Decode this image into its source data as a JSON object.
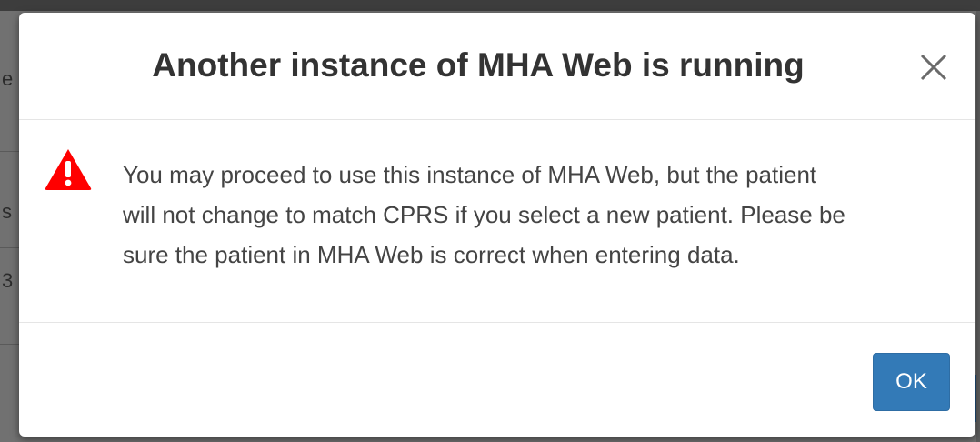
{
  "dialog": {
    "title": "Another instance of MHA Web is running",
    "close_label": "×",
    "warning_icon": "warning-triangle-icon",
    "message_lines": [
      "You may proceed to use this instance of MHA Web, but the patient",
      "will not change to match CPRS if you select a new patient. Please be",
      "sure the patient in MHA Web is correct when entering data."
    ],
    "ok_label": "OK"
  },
  "background": {
    "fragments": [
      "e",
      "s",
      "3"
    ]
  },
  "colors": {
    "warning": "#ff0000",
    "primary_button": "#337ab7",
    "overlay": "#717171"
  }
}
